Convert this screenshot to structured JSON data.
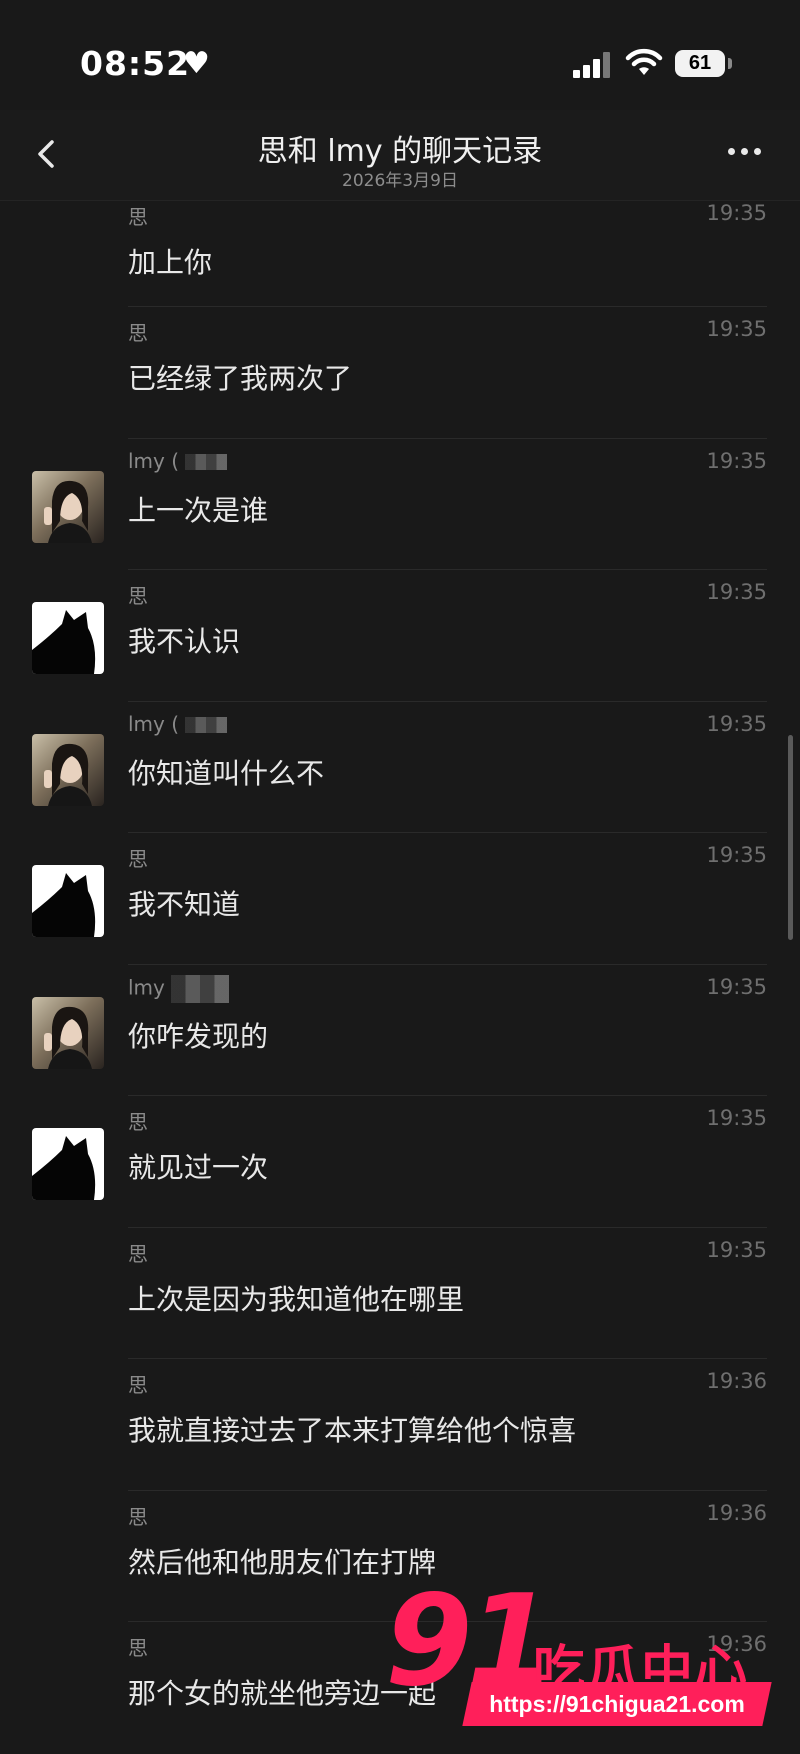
{
  "status_bar": {
    "time": "08:52",
    "battery": "61",
    "heart_icon": "heart-icon",
    "signal_icon": "cellular-signal-icon",
    "wifi_icon": "wifi-icon"
  },
  "nav": {
    "title": "思和 lmy 的聊天记录",
    "subtitle": "2026年3月9日",
    "back_icon": "chevron-left-icon",
    "more_icon": "ellipsis-icon"
  },
  "messages": [
    {
      "sender": "思",
      "time": "19:35",
      "text": "加上你",
      "avatar": "none"
    },
    {
      "sender": "思",
      "time": "19:35",
      "text": "已经绿了我两次了",
      "avatar": "none"
    },
    {
      "sender": "lmy (",
      "time": "19:35",
      "text": "上一次是谁",
      "avatar": "girl-photo"
    },
    {
      "sender": "思",
      "time": "19:35",
      "text": "我不认识",
      "avatar": "black-cat"
    },
    {
      "sender": "lmy (",
      "time": "19:35",
      "text": "你知道叫什么不",
      "avatar": "girl-photo"
    },
    {
      "sender": "思",
      "time": "19:35",
      "text": "我不知道",
      "avatar": "black-cat"
    },
    {
      "sender": "lmy",
      "time": "19:35",
      "text": "你咋发现的",
      "avatar": "girl-photo"
    },
    {
      "sender": "思",
      "time": "19:35",
      "text": "就见过一次",
      "avatar": "black-cat"
    },
    {
      "sender": "思",
      "time": "19:35",
      "text": "上次是因为我知道他在哪里",
      "avatar": "none"
    },
    {
      "sender": "思",
      "time": "19:36",
      "text": "我就直接过去了本来打算给他个惊喜",
      "avatar": "none"
    },
    {
      "sender": "思",
      "time": "19:36",
      "text": "然后他和他朋友们在打牌",
      "avatar": "none"
    },
    {
      "sender": "思",
      "time": "19:36",
      "text": "那个女的就坐他旁边一起",
      "avatar": "none"
    }
  ],
  "watermark": {
    "number": "91",
    "name": "吃瓜中心",
    "url": "https://91chigua21.com",
    "color": "#ff1f5a"
  }
}
